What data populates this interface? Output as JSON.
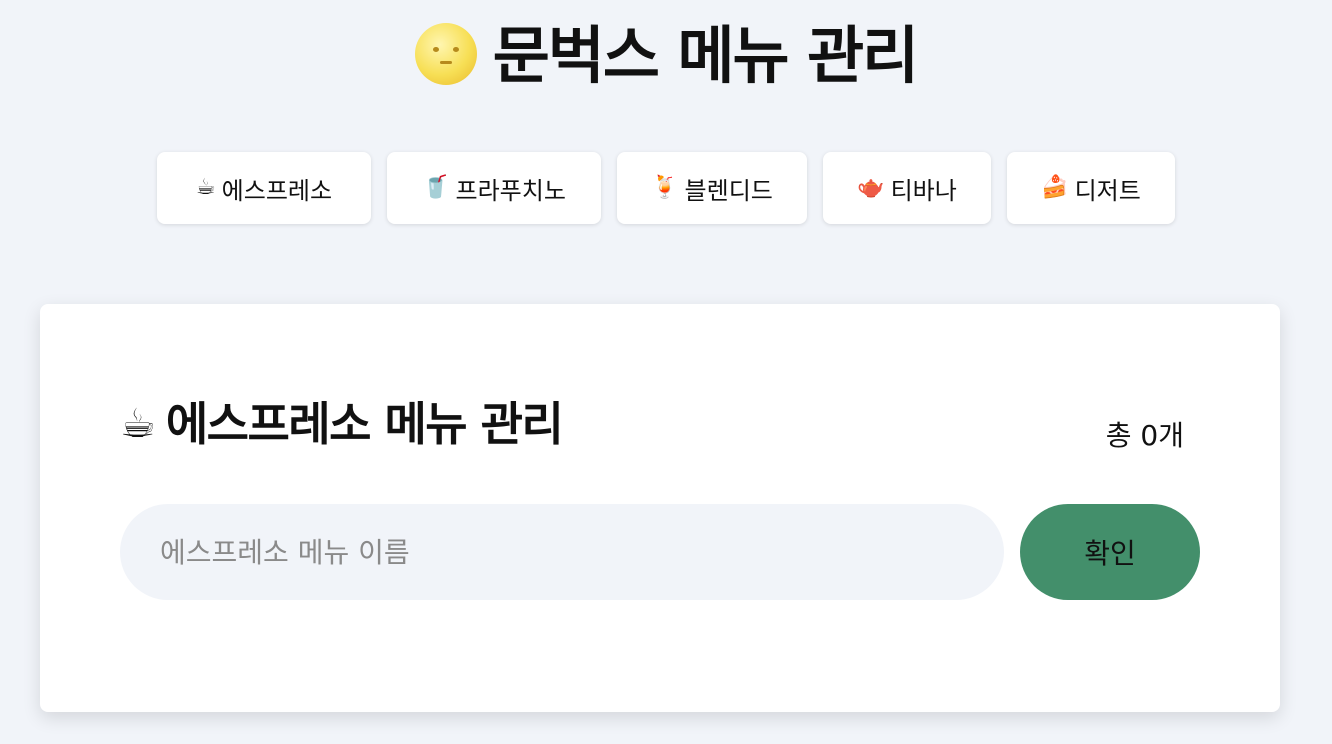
{
  "header": {
    "title": "문벅스 메뉴 관리",
    "icon": "full-moon-face-icon"
  },
  "nav": {
    "items": [
      {
        "icon": "☕",
        "icon_name": "hot-coffee-icon",
        "label": "에스프레소"
      },
      {
        "icon": "🥤",
        "icon_name": "cup-with-straw-icon",
        "label": "프라푸치노"
      },
      {
        "icon": "🍹",
        "icon_name": "tropical-drink-icon",
        "label": "블렌디드"
      },
      {
        "icon": "🫖",
        "icon_name": "teapot-icon",
        "label": "티바나"
      },
      {
        "icon": "🍰",
        "icon_name": "shortcake-icon",
        "label": "디저트"
      }
    ]
  },
  "main": {
    "icon": "☕",
    "icon_name": "hot-coffee-icon",
    "title": "에스프레소 메뉴 관리",
    "count_text": "총 0개",
    "input_placeholder": "에스프레소 메뉴 이름",
    "input_value": "",
    "submit_label": "확인"
  },
  "colors": {
    "background": "#f1f4f9",
    "card": "#ffffff",
    "accent_button": "#438f6b",
    "input_background": "#f1f4f9"
  }
}
